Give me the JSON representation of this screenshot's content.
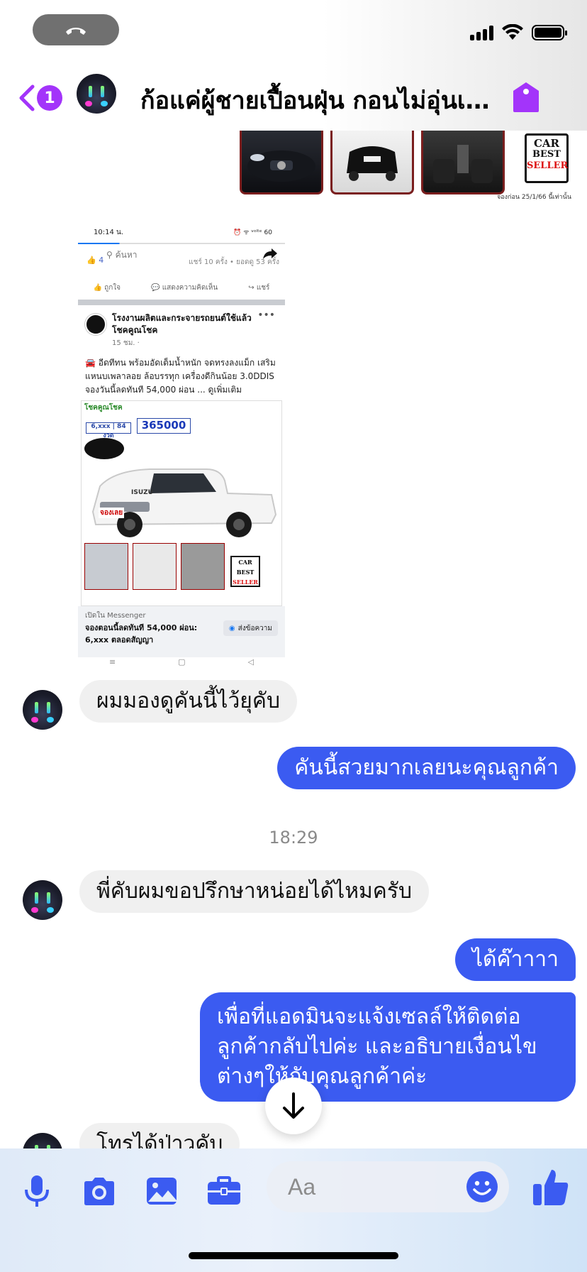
{
  "header": {
    "unread_count": "1",
    "title": "ก้อแค่ผู้ชายเปื้อนฝุ่น กอนไม่อุ่นเห..."
  },
  "top_image": {
    "seller_badge_1": "CAR",
    "seller_badge_2": "BEST",
    "seller_badge_3": "SELLER",
    "caption": "จองก่อน 25/1/66 นี้เท่านั้น"
  },
  "shared_post": {
    "status_time": "10:14 น.",
    "status_right": "⏰ ᯤ ᵛᵒˡᵗᵉ 60",
    "search_placeholder": "ค้นหา",
    "reaction_count": "4",
    "shares": "แชร์ 10 ครั้ง • ยอดดู 53 ครั้ง",
    "like_label": "ถูกใจ",
    "comment_label": "แสดงความคิดเห็น",
    "share_label": "แชร์",
    "page_name": "โรงงานผลิตและกระจายรถยนต์ใช้แล้ว โชคคูณโชค",
    "post_time": "15 ชม. ·",
    "body": "🚘 อีดทีทน พร้อมอัดเต็มน้ำหนัก จดทรงลงแม็ก เสริมแหนบเพลาลอย ล้อบรรทุก เครื่องดีกินน้อย 3.0DDIS จองวันนี้ลดทันที 54,000 ผ่อน ... ดูเพิ่มเติม",
    "ad_header": "โชคคูณโชค",
    "ad_installment": "6,xxx | 84 งวด",
    "ad_price": "365000",
    "ad_reserved": "จองเลย",
    "ad_brand": "ISUZU",
    "via": "เปิดใน Messenger",
    "caption": "จองตอนนี้ลดทันที 54,000 ผ่อน: 6,xxx ตลอดสัญญา",
    "button": "ส่งข้อความ"
  },
  "messages": [
    {
      "side": "in",
      "text": "ผมมองดูคันนี้ไว้ยุคับ"
    },
    {
      "side": "out",
      "text": "คันนี้สวยมากเลยนะคุณลูกค้า"
    },
    {
      "side": "in",
      "text": "พี่คับผมขอปรึกษาหน่อยได้ไหมครับ"
    },
    {
      "side": "out",
      "text": "ได้ค๊าาาา"
    },
    {
      "side": "out",
      "text": "เพื่อที่แอดมินจะแจ้งเซลล์ให้ติดต่อลูกค้ากลับไปค่ะ และอธิบายเงื่อนไขต่างๆให้กับคุณลูกค้าค่ะ"
    },
    {
      "side": "in",
      "text": "โทรได้ป่าวคับ"
    }
  ],
  "timestamp": "18:29",
  "composer": {
    "placeholder": "Aa"
  },
  "colors": {
    "accent": "#3b5bf1",
    "badge": "#a334fa",
    "incoming_bubble": "#f0f0f0"
  }
}
